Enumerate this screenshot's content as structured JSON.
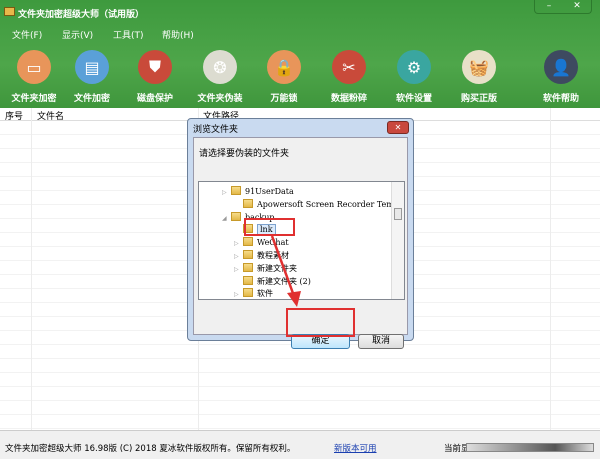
{
  "window": {
    "title": "文件夹加密超级大师（试用版）",
    "minimize": "–",
    "close": "✕"
  },
  "menu": [
    "文件(F)",
    "显示(V)",
    "工具(T)",
    "帮助(H)"
  ],
  "toolbar": [
    {
      "label": "文件夹加密",
      "icon": "folder-icon",
      "color": "#e8955a",
      "glyph": "▭"
    },
    {
      "label": "文件加密",
      "icon": "clipboard-icon",
      "color": "#5aa0d8",
      "glyph": "▤"
    },
    {
      "label": "磁盘保护",
      "icon": "shield-icon",
      "color": "#c94a3a",
      "glyph": "⛊"
    },
    {
      "label": "文件夹伪装",
      "icon": "palette-icon",
      "color": "#dcdcd0",
      "glyph": "❂"
    },
    {
      "label": "万能锁",
      "icon": "lock-icon",
      "color": "#e8955a",
      "glyph": "🔒"
    },
    {
      "label": "数据粉碎",
      "icon": "scissors-icon",
      "color": "#c94a3a",
      "glyph": "✂"
    },
    {
      "label": "软件设置",
      "icon": "gear-icon",
      "color": "#3aa6a0",
      "glyph": "⚙"
    },
    {
      "label": "购买正版",
      "icon": "basket-icon",
      "color": "#e8e0c8",
      "glyph": "🧺"
    },
    {
      "label": "软件帮助",
      "icon": "user-icon",
      "color": "#3e4a60",
      "glyph": "👤"
    }
  ],
  "table": {
    "columns": [
      "序号",
      "文件名",
      "文件路径"
    ]
  },
  "dialog": {
    "title": "浏览文件夹",
    "close": "✕",
    "prompt": "请选择要伪装的文件夹",
    "tree": [
      {
        "label": "91UserData",
        "expander": "▷"
      },
      {
        "label": "Apowersoft Screen Recorder Temp",
        "expander": ""
      },
      {
        "label": "backup",
        "expander": "◢"
      },
      {
        "label": "lnk",
        "expander": "",
        "selected": true
      },
      {
        "label": "WeChat",
        "expander": "▷"
      },
      {
        "label": "教程素材",
        "expander": "▷"
      },
      {
        "label": "新建文件夹",
        "expander": "▷"
      },
      {
        "label": "新建文件夹 (2)",
        "expander": ""
      },
      {
        "label": "软件",
        "expander": "▷"
      }
    ],
    "ok": "确定",
    "cancel": "取消"
  },
  "status": {
    "copyright": "文件夹加密超级大师 16.98版 (C) 2018  夏冰软件版权所有。保留所有权利。",
    "update_link": "新版本可用",
    "current": "当前显"
  }
}
